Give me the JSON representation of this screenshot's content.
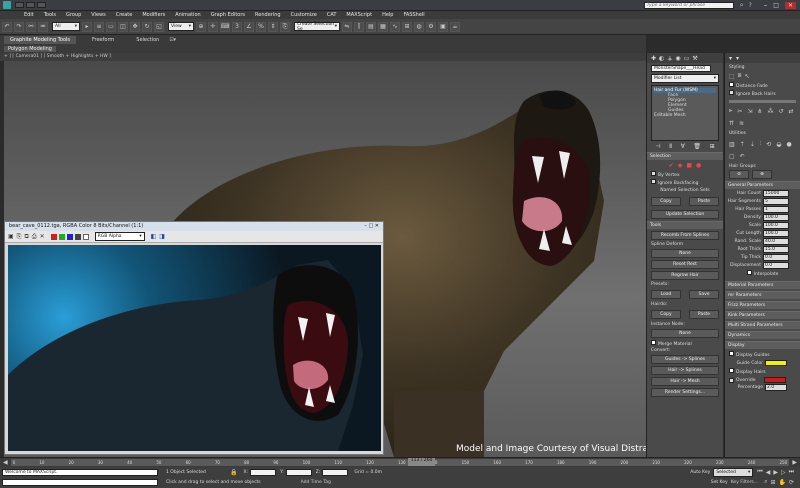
{
  "title_bar": {
    "search_placeholder": "Type a keyword or phrase"
  },
  "menu": [
    "Edit",
    "Tools",
    "Group",
    "Views",
    "Create",
    "Modifiers",
    "Animation",
    "Graph Editors",
    "Rendering",
    "Customize",
    "CAT",
    "MAXScript",
    "Help",
    "FASShell"
  ],
  "toolbar": {
    "selection_filter": "All",
    "coord_system": "View",
    "named_selection": "Create Selection Se"
  },
  "ribbon": {
    "tabs": [
      "Graphite Modeling Tools",
      "Freeform",
      "Selection"
    ],
    "sub_tab": "Polygon Modeling"
  },
  "viewport": {
    "label": "+ ] [ Camera01 ] [ Smooth + Highlights + HW ]"
  },
  "frame_window": {
    "title": "bear_cave_0112.tga, RGBA Color 8 Bits/Channel (1:1)",
    "channel": "RGB Alpha"
  },
  "credit": "Model and Image Courtesy of Visual Distractions Ltd.",
  "modify_panel": {
    "object_name": "MonsterShape___Head",
    "modifier_list": "Modifier List",
    "stack": [
      "Hair and Fur (WSM)",
      "Face",
      "Polygon",
      "Element",
      "Guides",
      "Editable Mesh"
    ],
    "selection_header": "Selection",
    "ignore_backfacing": "Ignore Backfacing",
    "by_vertex": "By Vertex",
    "named_selection_sets": "Named Selection Sets",
    "copy": "Copy",
    "paste": "Paste",
    "update_selection": "Update Selection",
    "tools_header": "Tools",
    "recomb_from_splines": "Recomb From Splines",
    "spline_deform": "Spline Deform",
    "none": "None",
    "reset_rest": "Reset Rest",
    "regrow_hair": "Regrow Hair",
    "presets": "Presets:",
    "load": "Load",
    "save": "Save",
    "hairdo": "Hairdo:",
    "instance_node": "Instance Node:",
    "merge_material": "Merge Material",
    "convert": "Convert:",
    "guides_to_splines": "Guides -> Splines",
    "hair_to_splines": "Hair -> Splines",
    "hair_to_mesh": "Hair -> Mesh",
    "render_settings": "Render Settings..."
  },
  "right_panel": {
    "styling": "Styling",
    "distance_fade": "Distance Fade",
    "ignore_back_hairs": "Ignore Back Hairs",
    "utilities": "Utilities",
    "hair_groups": "Hair Groups",
    "general_header": "General Parameters",
    "params": [
      {
        "label": "Hair Count",
        "value": "15000"
      },
      {
        "label": "Hair Segments",
        "value": "5"
      },
      {
        "label": "Hair Passes",
        "value": "1"
      },
      {
        "label": "Density",
        "value": "100.0"
      },
      {
        "label": "Scale",
        "value": "100.0"
      },
      {
        "label": "Cut Length",
        "value": "100.0"
      },
      {
        "label": "Rand. Scale",
        "value": "40.0"
      },
      {
        "label": "Root Thick",
        "value": "15.0"
      },
      {
        "label": "Tip Thick",
        "value": "0.0"
      },
      {
        "label": "Displacement",
        "value": "0.0"
      }
    ],
    "interpolate": "Interpolate",
    "rollouts": [
      "Material Parameters",
      "mr Parameters",
      "Frizz Parameters",
      "Kink Parameters",
      "Multi Strand Parameters",
      "Dynamics",
      "Display"
    ],
    "display_guides": "Display Guides",
    "guide_color": "Guide Color",
    "display_hairs": "Display Hairs",
    "override": "Override",
    "percentage": "Percentage",
    "percentage_value": "2.0",
    "colors": {
      "guide": "#f2f200",
      "override": "#d01818"
    }
  },
  "timeline": {
    "ticks": [
      "0",
      "10",
      "20",
      "30",
      "40",
      "50",
      "60",
      "70",
      "80",
      "90",
      "100",
      "110",
      "120",
      "130",
      "140",
      "150",
      "160",
      "170",
      "180",
      "190",
      "200",
      "210",
      "220",
      "230",
      "240",
      "250"
    ],
    "frame": "113 / 260"
  },
  "status": {
    "maxscript_text": "Welcome to MAXScript.",
    "objects_selected": "1 Object Selected",
    "prompt": "Click and drag to select and move objects",
    "x": "",
    "y": "",
    "z": "",
    "grid": "Grid = 0.0m",
    "add_time_tag": "Add Time Tag",
    "auto_key": "Auto Key",
    "set_key": "Set Key",
    "selected": "Selected",
    "key_filters": "Key Filters..."
  }
}
